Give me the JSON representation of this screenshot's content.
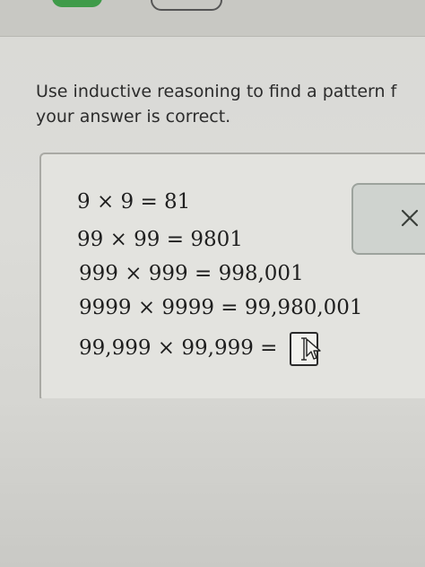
{
  "instructions": {
    "line1": "Use inductive reasoning to find a pattern f",
    "line2": "your answer is correct."
  },
  "equations": [
    "9 × 9 = 81",
    "99 × 99 = 9801",
    "999 × 999 = 998,001",
    "9999 × 9999 = 99,980,001"
  ],
  "question": {
    "left": "99,999 × 99,999 =",
    "input_value": ""
  },
  "side_panel": {
    "icon": "close-icon"
  },
  "colors": {
    "green_tab": "#3f9b49",
    "text": "#1f1f1f"
  }
}
